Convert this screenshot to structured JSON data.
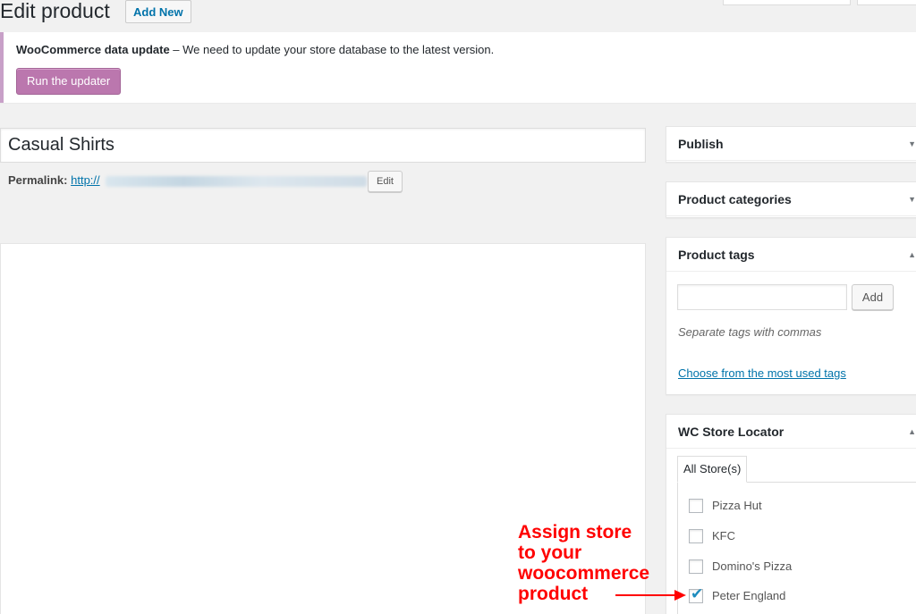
{
  "header": {
    "title": "Edit product",
    "add_new": "Add New"
  },
  "notice": {
    "bold_text": "WooCommerce data update",
    "text": " – We need to update your store database to the latest version.",
    "button": "Run the updater"
  },
  "post": {
    "title": "Casual Shirts",
    "permalink_label": "Permalink:",
    "permalink_url": "http://",
    "edit_button": "Edit"
  },
  "sidebar": {
    "publish": {
      "title": "Publish"
    },
    "categories": {
      "title": "Product categories"
    },
    "tags": {
      "title": "Product tags",
      "input_value": "",
      "add_button": "Add",
      "help": "Separate tags with commas",
      "link": "Choose from the most used tags"
    },
    "store_locator": {
      "title": "WC Store Locator",
      "tab": "All Store(s)",
      "stores": [
        {
          "label": "Pizza Hut",
          "checked": false
        },
        {
          "label": "KFC",
          "checked": false
        },
        {
          "label": "Domino's Pizza",
          "checked": false
        },
        {
          "label": "Peter England",
          "checked": true
        }
      ]
    }
  },
  "annotation": {
    "lines": [
      "Assign store",
      "to your",
      "woocommerce",
      "product"
    ],
    "color": "#ff0000"
  },
  "colors": {
    "accent_link": "#0073aa",
    "woo_button": "#bb77ae"
  },
  "icons": {
    "collapse": "triangle-down",
    "expand": "triangle-up",
    "check": "checkmark"
  }
}
